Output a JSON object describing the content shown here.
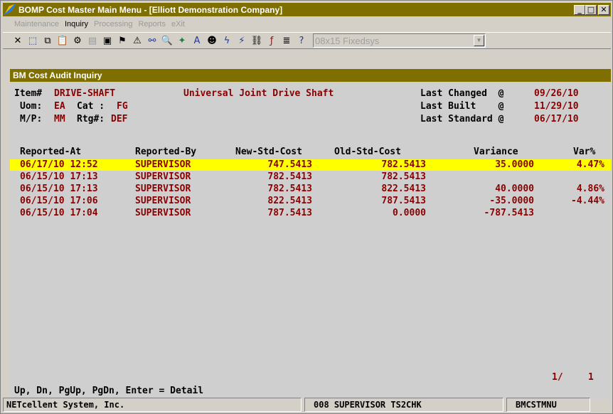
{
  "window": {
    "title": "BOMP Cost Master Main Menu - [Elliott Demonstration Company]",
    "buttons": [
      "_",
      "□",
      "✕"
    ]
  },
  "menu": [
    {
      "label": "Maintenance",
      "enabled": false
    },
    {
      "label": "Inquiry",
      "enabled": true
    },
    {
      "label": "Processing",
      "enabled": false
    },
    {
      "label": "Reports",
      "enabled": false
    },
    {
      "label": "eXit",
      "enabled": false
    }
  ],
  "toolbar": {
    "icons": [
      "close-x-icon",
      "select-icon",
      "copy-icon",
      "paste-icon",
      "settings-icon",
      "properties-icon",
      "list-icon",
      "users-icon",
      "alert-icon",
      "binoculars-icon",
      "zoom-icon",
      "tools-icon",
      "font-icon",
      "face-icon",
      "lightning-icon",
      "lightning-box-icon",
      "link-icon",
      "formula-icon",
      "notes-icon",
      "help-icon"
    ],
    "font_select": "08x15 Fixedsys"
  },
  "panel": {
    "title": "BM Cost Audit Inquiry"
  },
  "header_fields": {
    "item_label": "Item#",
    "item_value": "DRIVE-SHAFT",
    "item_desc": "Universal Joint Drive Shaft",
    "uom_label": "Uom:",
    "uom_value": "EA",
    "cat_label": "Cat :",
    "cat_value": "FG",
    "mp_label": "M/P:",
    "mp_value": "MM",
    "rtg_label": "Rtg#:",
    "rtg_value": "DEF",
    "last_changed_label": "Last Changed  @",
    "last_changed_value": "09/26/10",
    "last_built_label": "Last Built    @",
    "last_built_value": "11/29/10",
    "last_standard_label": "Last Standard @",
    "last_standard_value": "06/17/10"
  },
  "table": {
    "columns": [
      "Reported-At",
      "Reported-By",
      "New-Std-Cost",
      "Old-Std-Cost",
      "Variance",
      "Var%"
    ],
    "rows": [
      {
        "at": "06/17/10 12:52",
        "by": "SUPERVISOR",
        "new": "747.5413",
        "old": "782.5413",
        "variance": "35.0000",
        "pct": "4.47%",
        "selected": true
      },
      {
        "at": "06/15/10 17:13",
        "by": "SUPERVISOR",
        "new": "782.5413",
        "old": "782.5413",
        "variance": "",
        "pct": "",
        "selected": false
      },
      {
        "at": "06/15/10 17:13",
        "by": "SUPERVISOR",
        "new": "782.5413",
        "old": "822.5413",
        "variance": "40.0000",
        "pct": "4.86%",
        "selected": false
      },
      {
        "at": "06/15/10 17:06",
        "by": "SUPERVISOR",
        "new": "822.5413",
        "old": "787.5413",
        "variance": "-35.0000",
        "pct": "-4.44%",
        "selected": false
      },
      {
        "at": "06/15/10 17:04",
        "by": "SUPERVISOR",
        "new": "787.5413",
        "old": "0.0000",
        "variance": "-787.5413",
        "pct": "",
        "selected": false
      }
    ]
  },
  "paging": {
    "page": "1/",
    "total": "1"
  },
  "hint": "Up, Dn, PgUp, PgDn, Enter = Detail",
  "status": {
    "company": "NETcellent System, Inc.",
    "user": "008 SUPERVISOR TS2CHK",
    "program": "BMCSTMNU"
  },
  "colors": {
    "titlebar": "#7f6f00",
    "highlight": "#ffff00",
    "value_text": "#8b0000"
  }
}
